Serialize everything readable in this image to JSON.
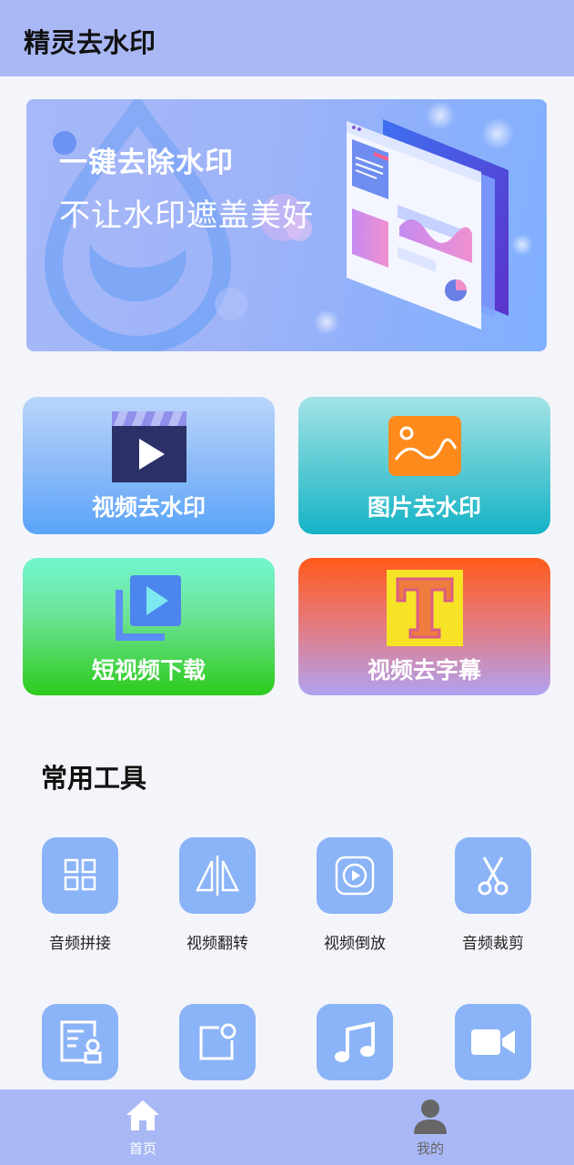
{
  "header": {
    "title": "精灵去水印"
  },
  "banner": {
    "headline": "一键去除水印",
    "subline": "不让水印遮盖美好",
    "illustration": "dashboard-illustration"
  },
  "feature_cards": [
    {
      "label": "视频去水印",
      "icon": "video-clapper-icon"
    },
    {
      "label": "图片去水印",
      "icon": "image-icon"
    },
    {
      "label": "短视频下载",
      "icon": "video-download-icon"
    },
    {
      "label": "视频去字幕",
      "icon": "subtitle-t-icon"
    }
  ],
  "tools_section": {
    "title": "常用工具",
    "items": [
      {
        "label": "音频拼接",
        "icon": "grid-squares-icon"
      },
      {
        "label": "视频翻转",
        "icon": "flip-icon"
      },
      {
        "label": "视频倒放",
        "icon": "reverse-play-icon"
      },
      {
        "label": "音频裁剪",
        "icon": "scissors-icon"
      },
      {
        "label": "",
        "icon": "document-user-icon"
      },
      {
        "label": "",
        "icon": "screen-notification-icon"
      },
      {
        "label": "",
        "icon": "music-note-icon"
      },
      {
        "label": "",
        "icon": "video-camera-icon"
      }
    ]
  },
  "tabbar": {
    "tabs": [
      {
        "label": "首页",
        "icon": "home-icon",
        "active": true
      },
      {
        "label": "我的",
        "icon": "person-icon",
        "active": false
      }
    ]
  },
  "colors": {
    "header_bg": "#a9b8f5",
    "tool_tile": "#8bb3f7",
    "active_tab": "#ffffff",
    "inactive_tab": "#666666"
  }
}
